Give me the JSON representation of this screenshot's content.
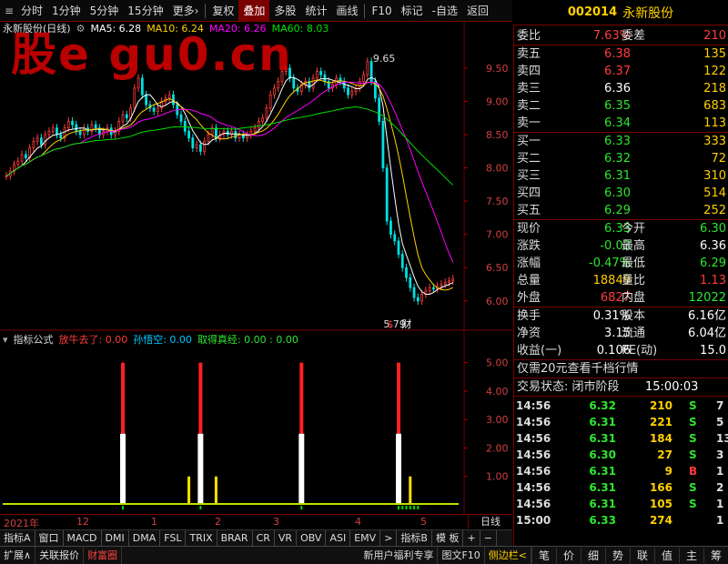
{
  "toolbar": {
    "items": [
      {
        "label": "分时",
        "active": false
      },
      {
        "label": "1分钟",
        "active": false
      },
      {
        "label": "5分钟",
        "active": false
      },
      {
        "label": "15分钟",
        "active": false
      },
      {
        "label": "更多›",
        "active": false
      },
      {
        "label": "复权",
        "active": false
      },
      {
        "label": "叠加",
        "active": true
      },
      {
        "label": "多股",
        "active": false
      },
      {
        "label": "统计",
        "active": false
      },
      {
        "label": "画线",
        "active": false
      },
      {
        "label": "F10",
        "active": false
      },
      {
        "label": "标记",
        "active": false
      },
      {
        "label": "-自选",
        "active": false
      },
      {
        "label": "返回",
        "active": false
      }
    ]
  },
  "watermark": "股e  gu0.cn",
  "header": {
    "code": "002014",
    "name": "永新股份"
  },
  "main_chart": {
    "name": "永新股份(日线)",
    "ma": [
      {
        "label": "MA5: 6.28",
        "color": "#ffffff"
      },
      {
        "label": "MA10: 6.24",
        "color": "#ffd000"
      },
      {
        "label": "MA20: 6.26",
        "color": "#ff00ff"
      },
      {
        "label": "MA60: 8.03",
        "color": "#00e000"
      }
    ],
    "high_label": "9.65",
    "low_label": "5.79",
    "marker_s": "$",
    "marker_cai": "财"
  },
  "indicator": {
    "title": "指标公式",
    "parts": [
      {
        "label": "放牛去了: 0.00",
        "color": "#ff3c3c"
      },
      {
        "label": "孙悟空: 0.00",
        "color": "#00c8ff"
      },
      {
        "label": "取得真经: 0.00 : 0.00",
        "color": "#2ee52e"
      }
    ]
  },
  "date_strip": {
    "labels": [
      {
        "text": "2021年",
        "pos": 4
      },
      {
        "text": "12",
        "pos": 84
      },
      {
        "text": "1",
        "pos": 166
      },
      {
        "text": "2",
        "pos": 236
      },
      {
        "text": "3",
        "pos": 300
      },
      {
        "text": "4",
        "pos": 390
      },
      {
        "text": "5",
        "pos": 462
      }
    ],
    "right": "日线"
  },
  "ind_tabs": [
    "指标A",
    "窗口",
    "MACD",
    "DMI",
    "DMA",
    "FSL",
    "TRIX",
    "BRAR",
    "CR",
    "VR",
    "OBV",
    "ASI",
    "EMV",
    ">",
    "指标B",
    "模 板",
    "+",
    "−"
  ],
  "bottom_bar": {
    "left": [
      {
        "label": "扩展∧",
        "color": ""
      },
      {
        "label": "关联报价",
        "color": ""
      },
      {
        "label": "财富圈",
        "color": "red"
      }
    ],
    "right": [
      {
        "label": "新用户福利专享",
        "color": ""
      },
      {
        "label": "图文F10",
        "color": ""
      },
      {
        "label": "侧边栏<",
        "color": "yellow"
      }
    ],
    "nav": [
      "笔",
      "价",
      "细",
      "势",
      "联",
      "值",
      "主",
      "筹"
    ]
  },
  "quote": {
    "webi_label": "委比",
    "webi": "7.63%",
    "wecha_label": "委差",
    "wecha": "210",
    "sell": [
      {
        "label": "卖五",
        "price": "6.38",
        "vol": "135",
        "pc": "red"
      },
      {
        "label": "卖四",
        "price": "6.37",
        "vol": "122",
        "pc": "red"
      },
      {
        "label": "卖三",
        "price": "6.36",
        "vol": "218",
        "pc": "white"
      },
      {
        "label": "卖二",
        "price": "6.35",
        "vol": "683",
        "pc": "green"
      },
      {
        "label": "卖一",
        "price": "6.34",
        "vol": "113",
        "pc": "green"
      }
    ],
    "buy": [
      {
        "label": "买一",
        "price": "6.33",
        "vol": "333",
        "pc": "green"
      },
      {
        "label": "买二",
        "price": "6.32",
        "vol": "72",
        "pc": "green"
      },
      {
        "label": "买三",
        "price": "6.31",
        "vol": "310",
        "pc": "green"
      },
      {
        "label": "买四",
        "price": "6.30",
        "vol": "514",
        "pc": "green"
      },
      {
        "label": "买五",
        "price": "6.29",
        "vol": "252",
        "pc": "green"
      }
    ],
    "stats": [
      {
        "l": "现价",
        "v": "6.33",
        "c": "green",
        "l2": "今开",
        "v2": "6.30",
        "c2": "green"
      },
      {
        "l": "涨跌",
        "v": "-0.03",
        "c": "green",
        "l2": "最高",
        "v2": "6.36",
        "c2": "white"
      },
      {
        "l": "涨幅",
        "v": "-0.47%",
        "c": "green",
        "l2": "最低",
        "v2": "6.29",
        "c2": "green"
      },
      {
        "l": "总量",
        "v": "18849",
        "c": "yellow",
        "l2": "量比",
        "v2": "1.13",
        "c2": "red"
      },
      {
        "l": "外盘",
        "v": "6827",
        "c": "red",
        "l2": "内盘",
        "v2": "12022",
        "c2": "green"
      }
    ],
    "stats2": [
      {
        "l": "换手",
        "v": "0.31%",
        "c": "white",
        "l2": "股本",
        "v2": "6.16亿",
        "c2": "white"
      },
      {
        "l": "净资",
        "v": "3.15",
        "c": "white",
        "l2": "流通",
        "v2": "6.04亿",
        "c2": "white"
      },
      {
        "l": "收益(一)",
        "v": "0.106",
        "c": "white",
        "l2": "PE(动)",
        "v2": "15.0",
        "c2": "white"
      }
    ],
    "promo": "仅需20元查看千档行情",
    "status_label": "交易状态: 闭市阶段",
    "status_time": "15:00:03"
  },
  "trades": [
    {
      "t": "14:56",
      "p": "6.32",
      "v": "210",
      "bs": "S",
      "n": "7",
      "pc": "green",
      "bc": "green"
    },
    {
      "t": "14:56",
      "p": "6.31",
      "v": "221",
      "bs": "S",
      "n": "5",
      "pc": "green",
      "bc": "green"
    },
    {
      "t": "14:56",
      "p": "6.31",
      "v": "184",
      "bs": "S",
      "n": "13",
      "pc": "green",
      "bc": "green"
    },
    {
      "t": "14:56",
      "p": "6.30",
      "v": "27",
      "bs": "S",
      "n": "3",
      "pc": "green",
      "bc": "green"
    },
    {
      "t": "14:56",
      "p": "6.31",
      "v": "9",
      "bs": "B",
      "n": "1",
      "pc": "green",
      "bc": "red"
    },
    {
      "t": "14:56",
      "p": "6.31",
      "v": "166",
      "bs": "S",
      "n": "2",
      "pc": "green",
      "bc": "green"
    },
    {
      "t": "14:56",
      "p": "6.31",
      "v": "105",
      "bs": "S",
      "n": "1",
      "pc": "green",
      "bc": "green"
    },
    {
      "t": "15:00",
      "p": "6.33",
      "v": "274",
      "bs": "",
      "n": "1",
      "pc": "green",
      "bc": "green"
    }
  ],
  "chart_data": [
    {
      "type": "candlestick",
      "title": "永新股份(日线)",
      "ylim": [
        5.6,
        9.95
      ],
      "yticks": [
        "9.50",
        "9.00",
        "8.50",
        "8.00",
        "7.50",
        "7.00",
        "6.50",
        "6.00"
      ],
      "close": [
        7.88,
        7.95,
        8.05,
        8.1,
        8.2,
        8.15,
        8.3,
        8.4,
        8.45,
        8.35,
        8.5,
        8.55,
        8.6,
        8.5,
        8.45,
        8.6,
        8.7,
        8.65,
        8.55,
        8.5,
        8.6,
        8.55,
        8.65,
        8.6,
        8.5,
        8.55,
        8.6,
        8.5,
        8.55,
        8.7,
        8.8,
        8.75,
        8.9,
        9.2,
        9.35,
        9.1,
        8.95,
        8.9,
        8.85,
        8.9,
        9.0,
        9.05,
        9.1,
        8.95,
        8.8,
        8.7,
        8.55,
        8.45,
        8.3,
        8.35,
        8.25,
        8.4,
        8.5,
        8.6,
        8.45,
        8.5,
        8.55,
        8.5,
        8.55,
        8.45,
        8.5,
        8.45,
        8.5,
        8.55,
        8.6,
        8.7,
        8.75,
        8.9,
        9.1,
        9.2,
        9.3,
        9.45,
        9.5,
        9.35,
        9.2,
        9.15,
        9.25,
        9.3,
        9.2,
        9.35,
        9.45,
        9.4,
        9.3,
        9.2,
        9.25,
        9.35,
        9.3,
        9.2,
        9.1,
        9.15,
        9.2,
        9.3,
        9.4,
        9.6,
        9.3,
        9.05,
        8.7,
        8.0,
        7.2,
        7.0,
        6.9,
        6.7,
        6.5,
        6.35,
        6.2,
        6.05,
        6.0,
        6.1,
        6.15,
        6.2,
        6.18,
        6.22,
        6.25,
        6.28,
        6.3,
        6.33
      ]
    },
    {
      "type": "bar",
      "title": "指标公式",
      "ylim": [
        0,
        5.5
      ],
      "yticks": [
        "5.00",
        "4.00",
        "3.00",
        "2.00",
        "1.00"
      ],
      "red_bars": [
        {
          "x": 30,
          "v": 5.0
        },
        {
          "x": 50,
          "v": 5.0
        },
        {
          "x": 76,
          "v": 5.0
        },
        {
          "x": 101,
          "v": 5.0
        }
      ],
      "white_bars": [
        {
          "x": 30,
          "v": 2.5
        },
        {
          "x": 50,
          "v": 2.5
        },
        {
          "x": 76,
          "v": 2.5
        },
        {
          "x": 101,
          "v": 2.5
        }
      ],
      "yellow_bars": [
        {
          "x": 47,
          "v": 1.0
        },
        {
          "x": 54,
          "v": 1.0
        },
        {
          "x": 104,
          "v": 1.0
        }
      ]
    }
  ]
}
